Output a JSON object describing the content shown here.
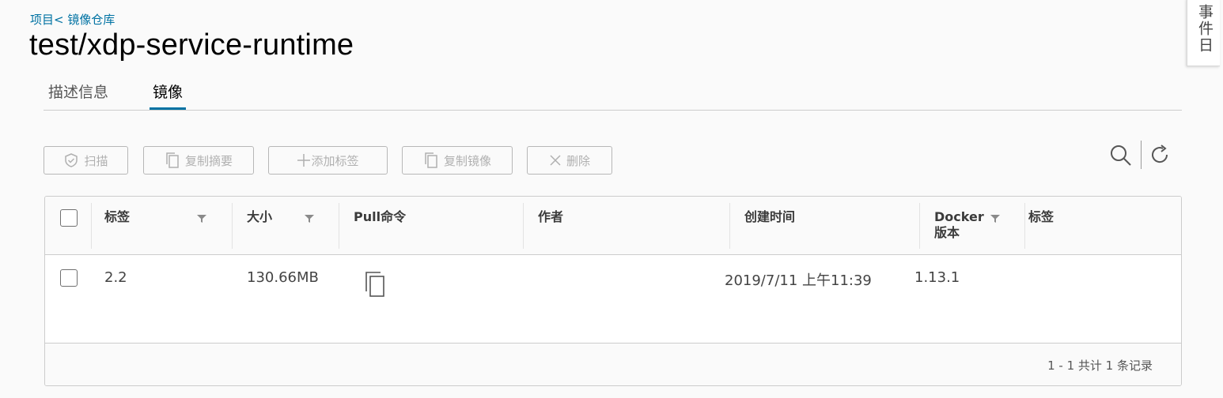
{
  "breadcrumb": {
    "project": "项目",
    "sep": "<",
    "repos": "镜像仓库"
  },
  "title": "test/xdp-service-runtime",
  "tabs": [
    {
      "label": "描述信息",
      "active": false
    },
    {
      "label": "镜像",
      "active": true
    }
  ],
  "side_panel": {
    "label": "事件日"
  },
  "toolbar": {
    "scan": "扫描",
    "copy_digest": "复制摘要",
    "add_label": "添加标签",
    "copy_image": "复制镜像",
    "delete": "删除"
  },
  "columns": {
    "tag": "标签",
    "size": "大小",
    "pull": "Pull命令",
    "author": "作者",
    "created": "创建时间",
    "docker_l1": "Docker",
    "docker_l2": "版本",
    "labels": "标签"
  },
  "rows": [
    {
      "tag": "2.2",
      "size": "130.66MB",
      "author": "",
      "created": "2019/7/11 上午11:39",
      "docker": "1.13.1",
      "labels": ""
    }
  ],
  "footer": "1 - 1 共计 1 条记录",
  "colors": {
    "accent": "#0072a3",
    "disabled": "#b0b0b0"
  }
}
